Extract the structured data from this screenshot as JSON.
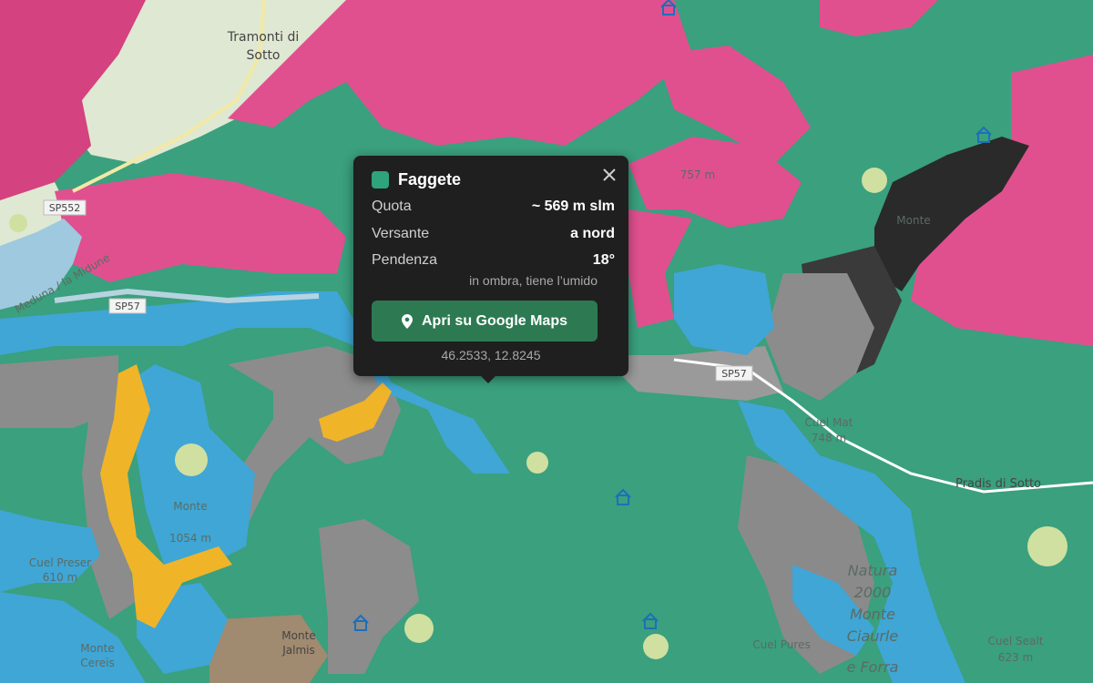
{
  "map": {
    "place_labels": {
      "tramonti_line1": "Tramonti di",
      "tramonti_line2": "Sotto",
      "pradis": "Pradis di Sotto",
      "monte_rosso": "Monte",
      "cuel_preser": "Cuel Preser",
      "cuel_preser_elev": "610 m",
      "monte_valcalda": "Monte",
      "monte_valcalda_elev": "1054 m",
      "monte_taiutis": "Monte",
      "monte_taiutis2": "Jalmis",
      "monte_cereis": "Monte",
      "monte_cereis2": "Cereis",
      "cuel_mat": "Cuel Mat",
      "cuel_mat_elev": "748 m",
      "cuel_sealt": "Cuel Sealt",
      "cuel_sealt_elev": "623 m",
      "natura": "Natura",
      "natura2": "2000",
      "natura3": "Monte",
      "natura4": "Ciaurle",
      "natura5": "e Forra",
      "elev_757": "757 m",
      "river": "Meduna / la Midune",
      "cuel_pures": "Cuel Pures"
    },
    "road_labels": {
      "sp552": "SP552",
      "sp57a": "SP57",
      "sp57b": "SP57"
    }
  },
  "popup": {
    "title": "Faggete",
    "swatch_color": "#2fa37c",
    "rows": [
      {
        "key": "Quota",
        "value": "~ 569 m slm"
      },
      {
        "key": "Versante",
        "value": "a nord"
      },
      {
        "key": "Pendenza",
        "value": "18°"
      }
    ],
    "note": "in ombra, tiene l’umido",
    "button_label": "Apri su Google Maps",
    "coords": "46.2533, 12.8245",
    "close_icon": "close-icon",
    "pin_icon": "map-pin-icon"
  },
  "colors": {
    "beech_forest": "#3aa07e",
    "pink_zone": "#e0508f",
    "blue_zone": "#3fa6d6",
    "grey_zone": "#8c8c8c",
    "yellow_zone": "#f0b429",
    "dark_zone": "#222"
  }
}
